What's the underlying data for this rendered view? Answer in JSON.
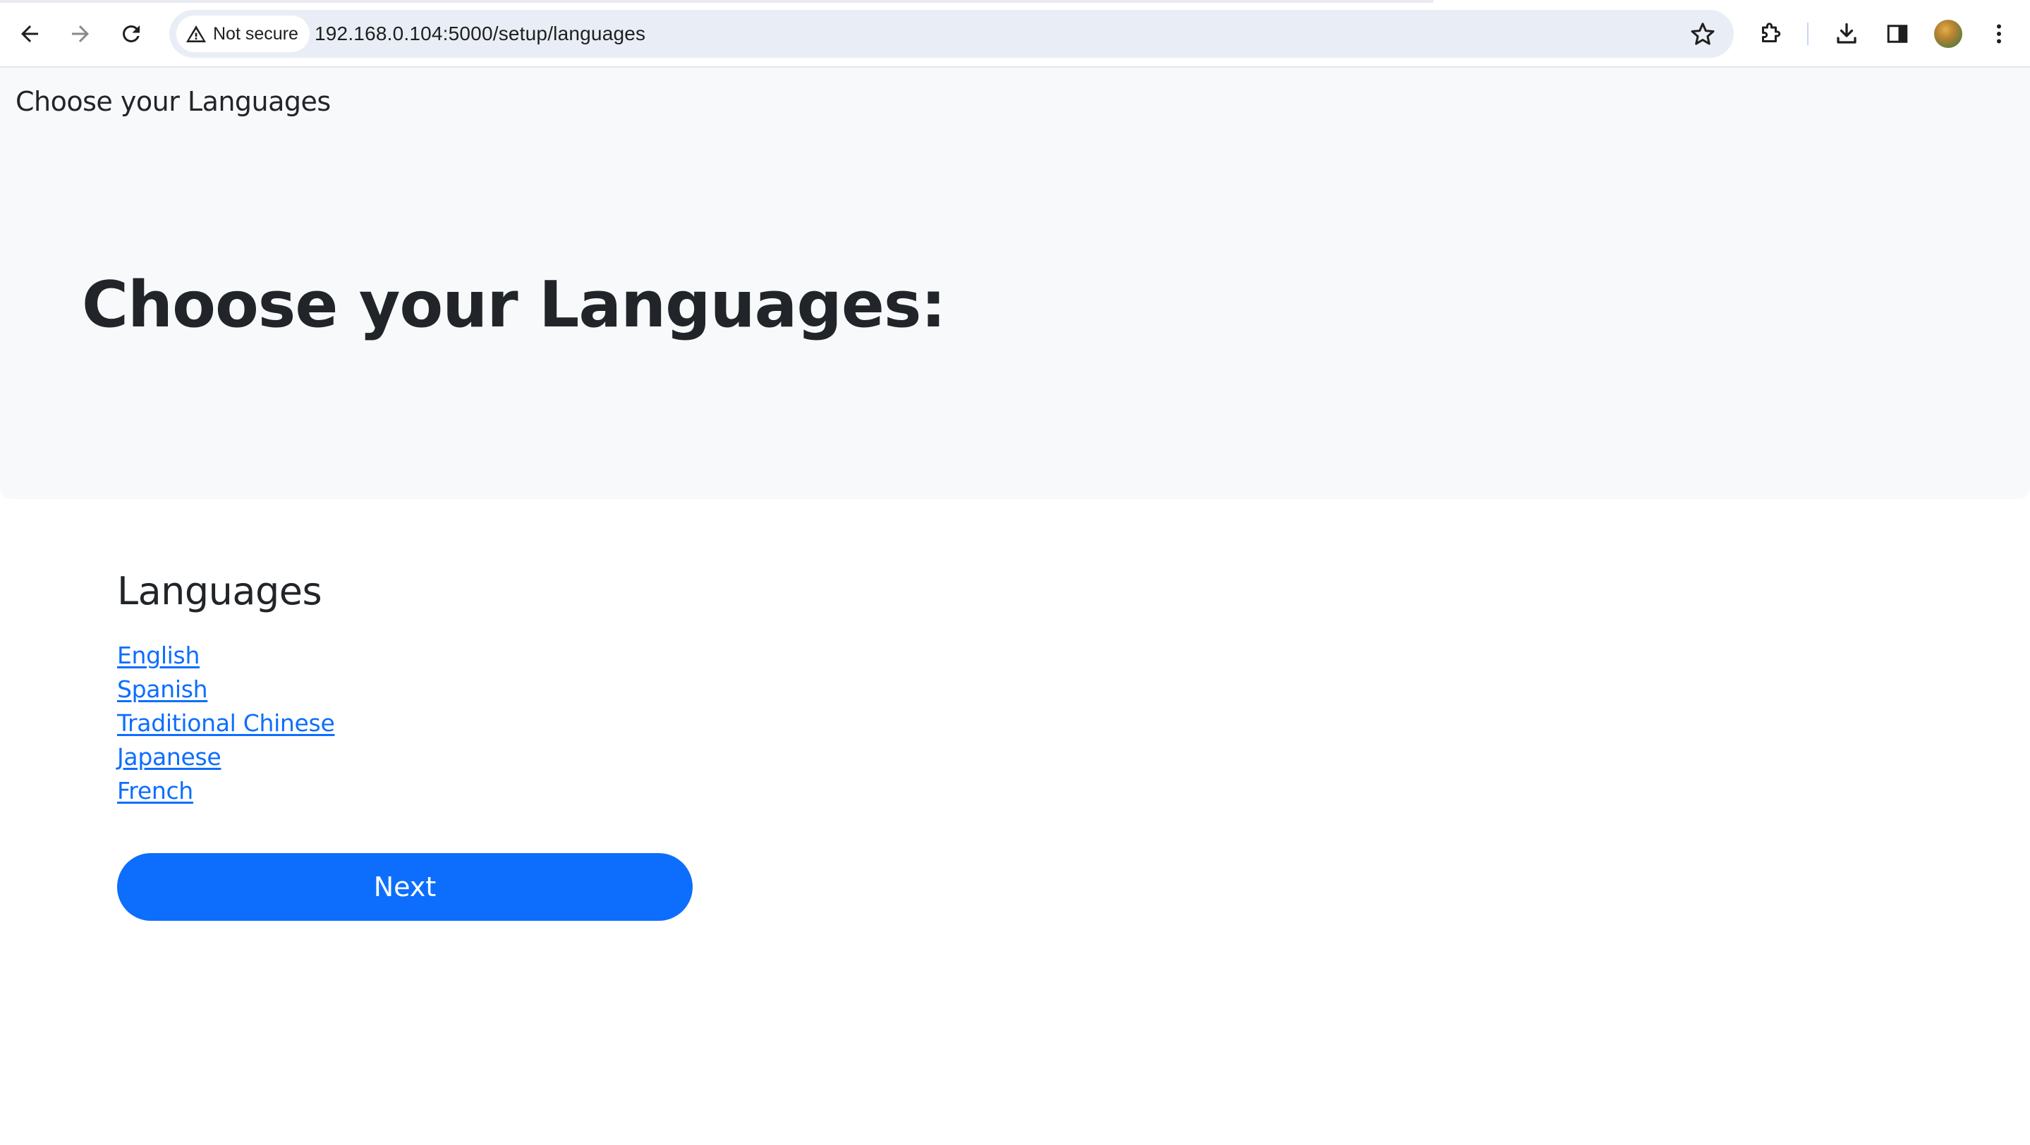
{
  "browser": {
    "security_label": "Not secure",
    "url": "192.168.0.104:5000/setup/languages",
    "icons": {
      "back": "back-arrow-icon",
      "forward": "forward-arrow-icon",
      "reload": "reload-icon",
      "security": "warning-triangle-icon",
      "bookmark": "star-icon",
      "extensions": "puzzle-icon",
      "downloads": "download-icon",
      "side_panel": "side-panel-icon",
      "profile": "avatar",
      "menu": "kebab-menu-icon"
    }
  },
  "navbar": {
    "brand": "Choose your Languages"
  },
  "hero": {
    "title": "Choose your Languages:"
  },
  "languages": {
    "heading": "Languages",
    "items": [
      "English",
      "Spanish",
      "Traditional Chinese",
      "Japanese",
      "French"
    ]
  },
  "actions": {
    "next_label": "Next"
  },
  "colors": {
    "primary": "#0d6efd",
    "link": "#0d6efd",
    "light_bg": "#f8f9fa",
    "text": "#212529"
  }
}
